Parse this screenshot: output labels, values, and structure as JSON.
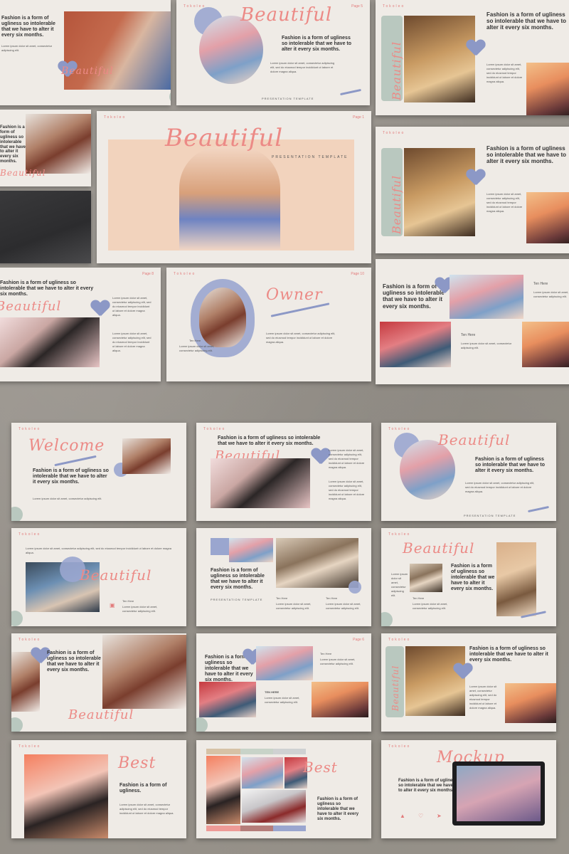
{
  "brand": "Tokoleo",
  "pages": {
    "p1": "Page 5",
    "p2": "Page 6",
    "p3": "Page 1",
    "p4": "Page 8",
    "p5": "Page 10"
  },
  "script_words": {
    "beautiful": "Beautiful",
    "owner": "Owner",
    "welcome": "Welcome",
    "best": "Best",
    "mockup": "Mockup"
  },
  "taglines": {
    "presentation_template": "PRESENTATION TEMPLATE",
    "presentation_template_small": "PRESENTATION TEMPLATE"
  },
  "texts": {
    "fashion_long": "Fashion is a form of ugliness so intolerable that we have to alter it every six months.",
    "fashion_short": "Fashion is a form of ugliness.",
    "lorem": "Lorem ipsum dolor sit amet, consectetur adipiscing elit, sed do eiusmod tempor incididunt ut labore et dolore magna aliqua.",
    "lorem_short": "Lorem ipsum dolor sit amet, consectetur adipiscing elit.",
    "ten_here": "Ten Here",
    "ten_here_upper": "TEN HERE"
  },
  "icons": [
    "heart-shape-icon",
    "thumb-icon",
    "heart-outline-icon",
    "send-icon",
    "camera-icon"
  ],
  "colors": {
    "background": "#9a958e",
    "slide": "#efebe6",
    "accent_pink": "#ec8a86",
    "accent_blue": "#8c98c6",
    "sage": "#b9c8bf"
  }
}
